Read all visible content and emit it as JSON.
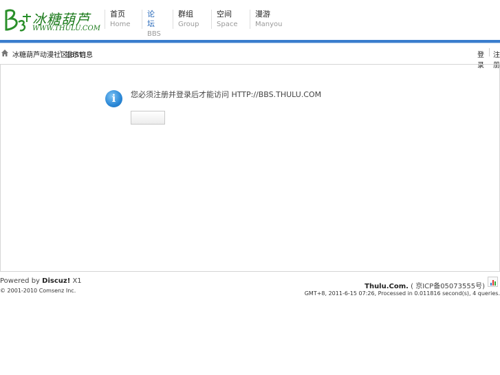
{
  "logo": {
    "script": "冰糖葫芦",
    "url": "WWW.THULU.COM"
  },
  "nav": [
    {
      "cn": "首页",
      "en": "Home"
    },
    {
      "cn": "论坛",
      "en": "BBS"
    },
    {
      "cn": "群组",
      "en": "Group"
    },
    {
      "cn": "空间",
      "en": "Space"
    },
    {
      "cn": "漫游",
      "en": "Manyou"
    }
  ],
  "breadcrumb": {
    "site": "冰糖葫芦动漫社区[BST]",
    "separator": "›",
    "page": "提示信息"
  },
  "top_links": {
    "a": "登录",
    "b": "注册"
  },
  "message": {
    "text": "您必须注册并登录后才能访问 HTTP://BBS.THULU.COM",
    "button_label": ""
  },
  "footer": {
    "powered_prefix": "Powered by",
    "powered_brand": "Discuz!",
    "powered_version": "X1",
    "copyright": "© 2001-2010 Comsenz Inc.",
    "site_name": "Thulu.Com.",
    "icp": "( 京ICP备05073555号)",
    "process": "GMT+8, 2011-6-15 07:26, Processed in 0.011816 second(s), 4 queries."
  },
  "colors": {
    "accent": "#3a7dcd",
    "active_nav": "#2466b8",
    "logo_green": "#1b7a1b"
  },
  "icons": [
    "home-icon",
    "info-icon",
    "stats-icon"
  ]
}
